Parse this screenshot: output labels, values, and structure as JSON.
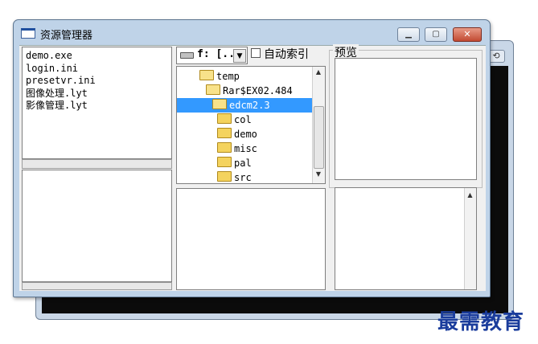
{
  "window": {
    "title": "资源管理器",
    "buttons": {
      "minimize": "▁",
      "maximize": "▢",
      "close": "✕"
    }
  },
  "background_window": {
    "button": "⟲"
  },
  "file_list": {
    "items": [
      "demo.exe",
      "login.ini",
      "presetvr.ini",
      "图像处理.lyt",
      "影像管理.lyt"
    ]
  },
  "drive": {
    "label": "f: [..",
    "arrow": "▼"
  },
  "autoindex": {
    "label": "自动索引",
    "checked": false
  },
  "tree": {
    "items": [
      {
        "label": "temp",
        "open": true,
        "selected": false
      },
      {
        "label": "Rar$EX02.484",
        "open": true,
        "selected": false
      },
      {
        "label": "edcm2.3",
        "open": true,
        "selected": true
      },
      {
        "label": "col",
        "open": false,
        "selected": false
      },
      {
        "label": "demo",
        "open": false,
        "selected": false
      },
      {
        "label": "misc",
        "open": false,
        "selected": false
      },
      {
        "label": "pal",
        "open": false,
        "selected": false
      },
      {
        "label": "src",
        "open": false,
        "selected": false
      }
    ],
    "scroll_up": "▲",
    "scroll_down": "▼"
  },
  "preview": {
    "label": "预览",
    "scroll_up": "▲"
  },
  "watermark": "最需教育",
  "colors": {
    "selection": "#3399ff",
    "watermark": "#1a3c9c",
    "folder": "#f4d35e"
  }
}
